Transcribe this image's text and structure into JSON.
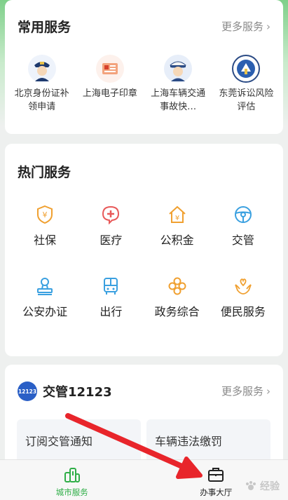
{
  "common": {
    "title": "常用服务",
    "more": "更多服务",
    "items": [
      {
        "label": "北京身份证补领申请",
        "icon": "police-avatar-icon"
      },
      {
        "label": "上海电子印章",
        "icon": "seal-card-icon"
      },
      {
        "label": "上海车辆交通事故快…",
        "icon": "traffic-police-icon"
      },
      {
        "label": "东莞诉讼风险评估",
        "icon": "court-emblem-icon"
      }
    ]
  },
  "hot": {
    "title": "热门服务",
    "items": [
      {
        "label": "社保",
        "icon": "shield-yen-icon",
        "color": "#f0a030"
      },
      {
        "label": "医疗",
        "icon": "medical-cross-icon",
        "color": "#e85a5a"
      },
      {
        "label": "公积金",
        "icon": "house-yen-icon",
        "color": "#f0a030"
      },
      {
        "label": "交管",
        "icon": "steering-wheel-icon",
        "color": "#3aa0e0"
      },
      {
        "label": "公安办证",
        "icon": "stamp-icon",
        "color": "#3aa0e0"
      },
      {
        "label": "出行",
        "icon": "bus-icon",
        "color": "#3aa0e0"
      },
      {
        "label": "政务综合",
        "icon": "flower-icon",
        "color": "#f0a030"
      },
      {
        "label": "便民服务",
        "icon": "hands-heart-icon",
        "color": "#f0a030"
      }
    ]
  },
  "traffic": {
    "logo_text": "12123",
    "title": "交管12123",
    "more": "更多服务",
    "cards": [
      "订阅交管通知",
      "车辆违法缴罚"
    ]
  },
  "tabbar": {
    "tabs": [
      {
        "label": "城市服务",
        "active": true
      },
      {
        "label": "办事大厅",
        "active": false
      }
    ]
  },
  "watermark": "经验",
  "colors": {
    "accent": "#2fae47",
    "arrow": "#e8252b"
  }
}
